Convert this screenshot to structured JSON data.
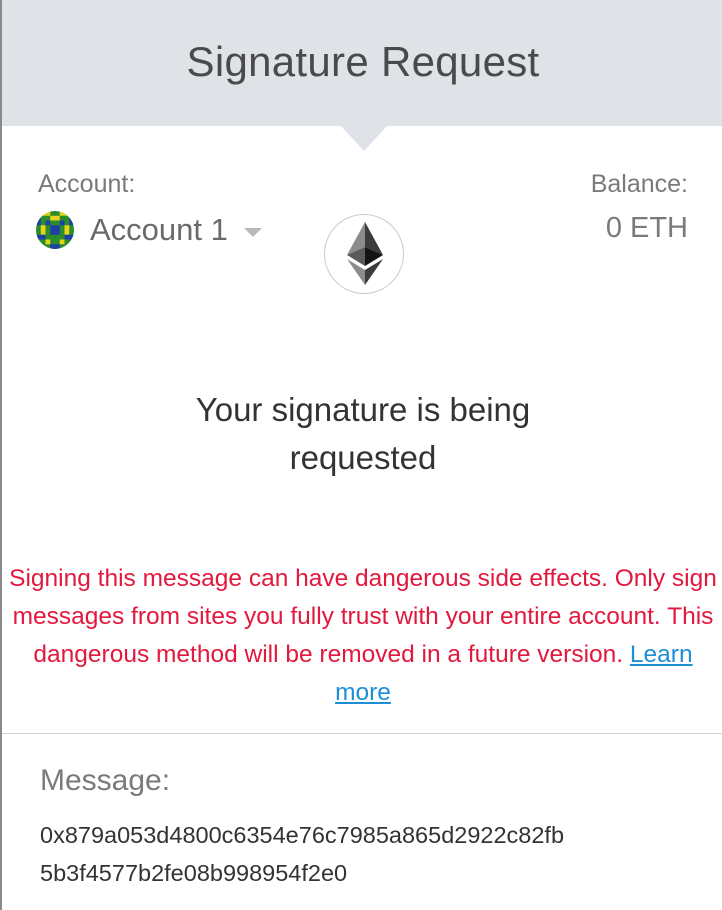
{
  "header": {
    "title": "Signature Request"
  },
  "account": {
    "label": "Account:",
    "name": "Account 1"
  },
  "balance": {
    "label": "Balance:",
    "value": "0 ETH"
  },
  "request": {
    "title_line1": "Your signature is being",
    "title_line2": "requested"
  },
  "warning": {
    "text": "Signing this message can have dangerous side effects. Only sign messages from sites you fully trust with your entire account. This dangerous method will be removed in a future version.",
    "link_label": "Learn more"
  },
  "message": {
    "label": "Message:",
    "line1": "0x879a053d4800c6354e76c7985a865d2922c82fb",
    "line2": "5b3f4577b2fe08b998954f2e0"
  },
  "colors": {
    "header_bg": "#dfe3e8",
    "warning": "#e2183d",
    "link": "#1d8fd6"
  },
  "icons": [
    "account-identicon",
    "chevron-down-icon",
    "ethereum-logo-icon"
  ]
}
